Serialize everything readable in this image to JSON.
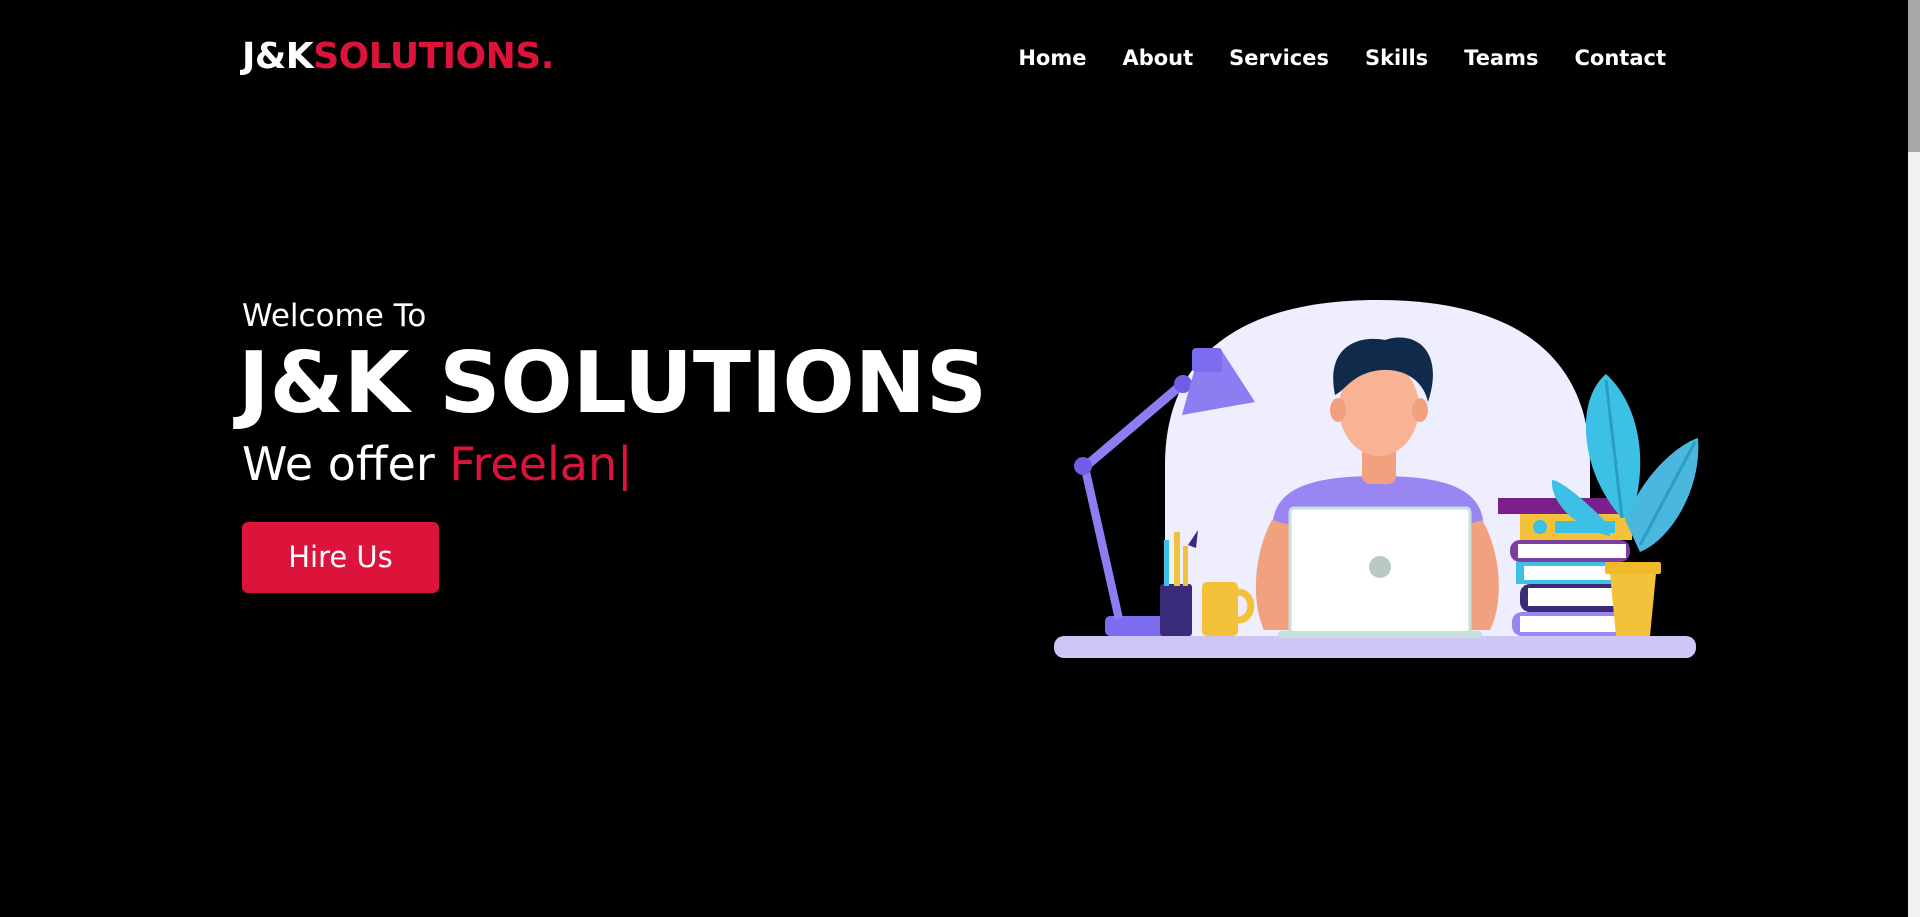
{
  "navbar": {
    "logo_main": "J&K",
    "logo_accent": "SOLUTIONS.",
    "items": [
      {
        "label": "Home"
      },
      {
        "label": "About"
      },
      {
        "label": "Services"
      },
      {
        "label": "Skills"
      },
      {
        "label": "Teams"
      },
      {
        "label": "Contact"
      }
    ]
  },
  "hero": {
    "welcome": "Welcome To",
    "title": "J&K SOLUTIONS",
    "offer_prefix": "We offer ",
    "offer_typed": "Freelan",
    "offer_cursor": "|",
    "hire_label": "Hire Us"
  },
  "colors": {
    "background": "#000000",
    "accent": "#dc143c",
    "text": "#ffffff"
  },
  "illustration": {
    "icon": "person-at-laptop-illustration"
  }
}
